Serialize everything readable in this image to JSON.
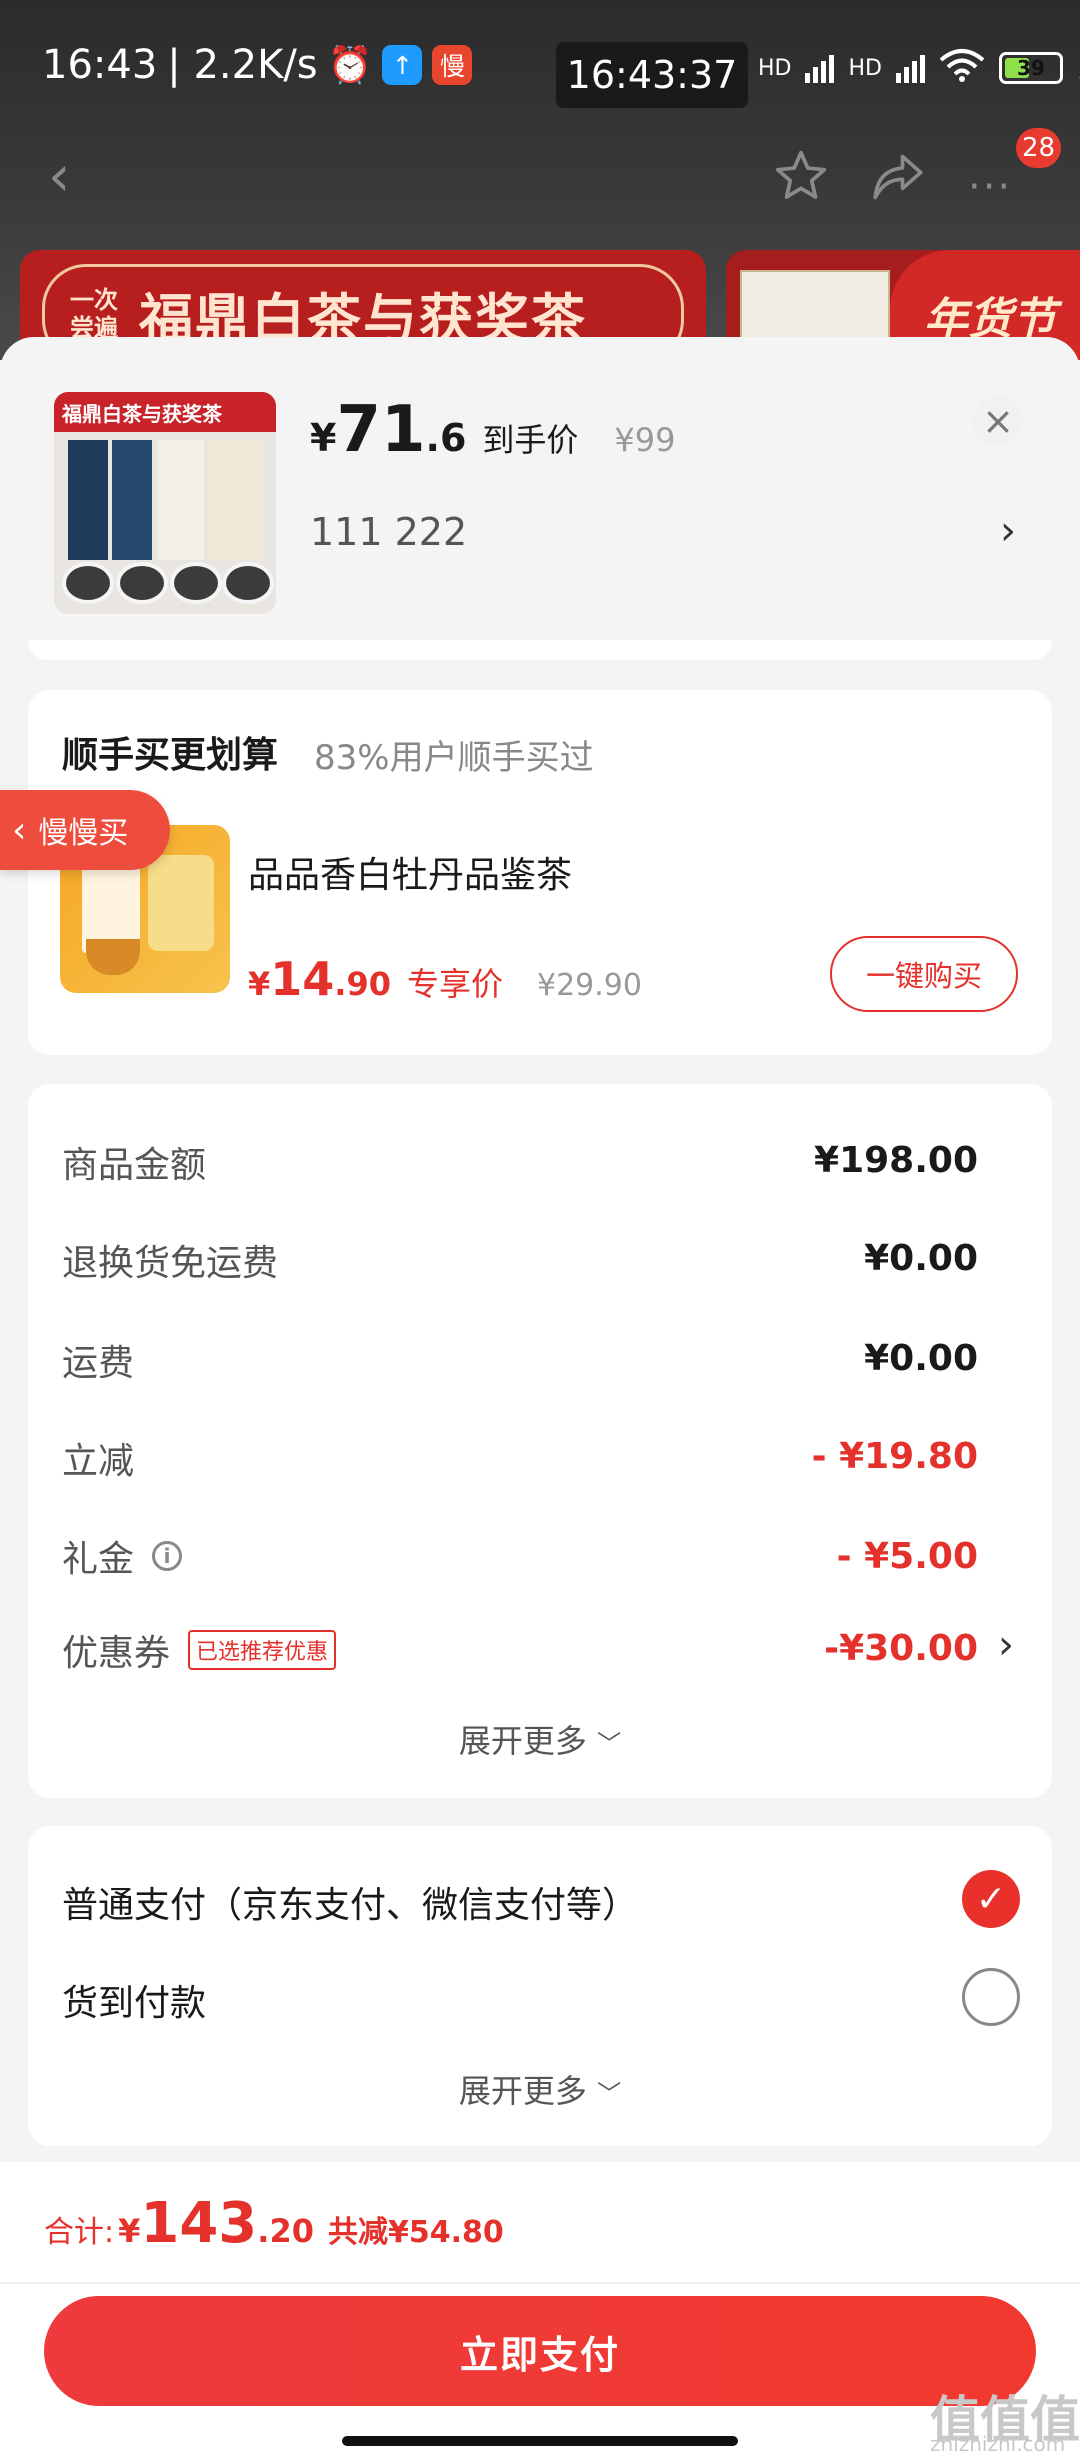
{
  "status_bar": {
    "time": "16:43",
    "speed": "| 2.2K/s",
    "slow_app": "慢",
    "floating_clock": "16:43:37",
    "network": "HD",
    "battery": "39"
  },
  "nav": {
    "badge": "28"
  },
  "banner": {
    "small_text": "一次尝遍",
    "big_text": "福鼎白茶与获奖茶",
    "holiday_text": "年货节"
  },
  "product": {
    "image_header": "福鼎白茶与获奖茶",
    "currency": "¥",
    "price_int": "71",
    "price_dec": ".6",
    "price_tag": "到手价",
    "orig_price": "¥99",
    "spec": "111  222"
  },
  "addon": {
    "title": "顺手买更划算",
    "subtitle": "83%用户顺手买过",
    "slow_tag": "慢慢买",
    "item_name": "品品香白牡丹品鉴茶",
    "currency": "¥",
    "price_int": "14",
    "price_dec": ".90",
    "price_tag": "专享价",
    "orig_price": "¥29.90",
    "buy_button": "一键购买"
  },
  "summary": {
    "rows": [
      {
        "label": "商品金额",
        "value": "¥198.00"
      },
      {
        "label": "退换货免运费",
        "value": "¥0.00"
      },
      {
        "label": "运费",
        "value": "¥0.00"
      },
      {
        "label": "立减",
        "value": "- ¥19.80"
      },
      {
        "label": "礼金",
        "value": "- ¥5.00"
      },
      {
        "label": "优惠券",
        "value": "-¥30.00"
      }
    ],
    "coupon_tag": "已选推荐优惠",
    "expand": "展开更多"
  },
  "payment": {
    "options": [
      {
        "label": "普通支付（京东支付、微信支付等）",
        "selected": true
      },
      {
        "label": "货到付款",
        "selected": false
      }
    ],
    "expand": "展开更多"
  },
  "footer": {
    "total_label": "合计:",
    "currency": "¥",
    "total_int": "143",
    "total_dec": ".20",
    "saved": "共减¥54.80",
    "pay_button": "立即支付"
  },
  "watermark": {
    "big": "值值值",
    "small": "zhizhizhi.com"
  },
  "colors": {
    "accent_red": "#e4312b",
    "pay_button": "#ee3a3d"
  }
}
